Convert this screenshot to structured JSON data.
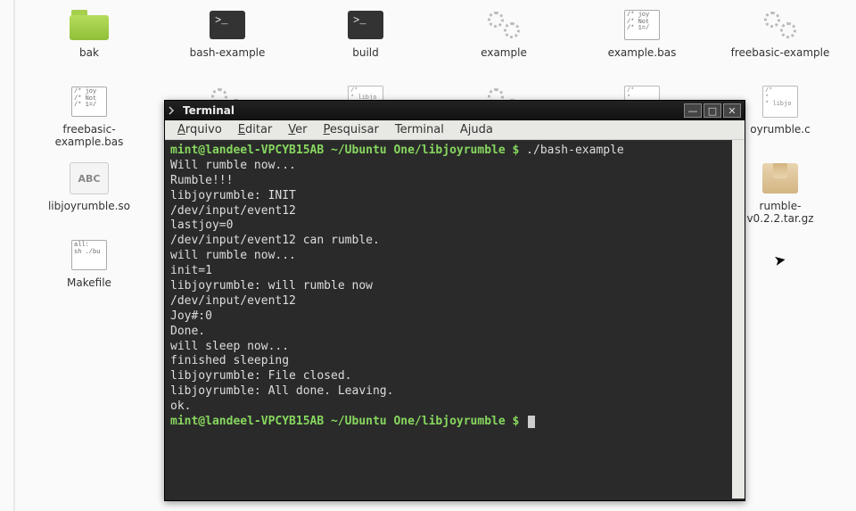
{
  "desktop_icons": [
    {
      "label": "bak",
      "kind": "folder"
    },
    {
      "label": "bash-example",
      "kind": "exe"
    },
    {
      "label": "build",
      "kind": "exe"
    },
    {
      "label": "example",
      "kind": "gear"
    },
    {
      "label": "example.bas",
      "kind": "script",
      "preview": "/* joy\n/* Not\n/* 1=/"
    },
    {
      "label": "freebasic-example",
      "kind": "gear"
    },
    {
      "label": "freebasic-example.bas",
      "kind": "script",
      "preview": "/* joy\n/* Not\n/* 1=/"
    },
    {
      "label": "",
      "kind": "gear"
    },
    {
      "label": "",
      "kind": "text",
      "preview": "/*\n* libjo"
    },
    {
      "label": "",
      "kind": "gear"
    },
    {
      "label": "",
      "kind": "text",
      "preview": "/*\n*\n*"
    },
    {
      "label": "oyrumble.c",
      "kind": "text",
      "preview": "/*\n*\n* libjo"
    },
    {
      "label": "libjoyrumble.so",
      "kind": "so"
    },
    {
      "label": "",
      "kind": "none"
    },
    {
      "label": "",
      "kind": "none"
    },
    {
      "label": "",
      "kind": "none"
    },
    {
      "label": "",
      "kind": "none"
    },
    {
      "label": "rumble-v0.2.2.tar.gz",
      "kind": "archive"
    },
    {
      "label": "Makefile",
      "kind": "script",
      "preview": "all:\nsh ./bu"
    }
  ],
  "terminal": {
    "title": "Terminal",
    "menu": {
      "arquivo": "Arquivo",
      "editar": "Editar",
      "ver": "Ver",
      "pesquisar": "Pesquisar",
      "terminal": "Terminal",
      "ajuda": "Ajuda"
    },
    "prompt_user": "mint@landeel-VPCYB15AB",
    "prompt_path": "~/Ubuntu One/libjoyrumble",
    "prompt_sym": "$",
    "command": "./bash-example",
    "output": [
      "Will rumble now...",
      "Rumble!!!",
      "libjoyrumble: INIT",
      "/dev/input/event12",
      "lastjoy=0",
      "/dev/input/event12 can rumble.",
      "will rumble now...",
      "init=1",
      "libjoyrumble: will rumble now",
      "/dev/input/event12",
      "Joy#:0",
      "Done.",
      "will sleep now...",
      "finished sleeping",
      "libjoyrumble: File closed.",
      "libjoyrumble: All done. Leaving.",
      "ok."
    ],
    "window_buttons": {
      "min": "—",
      "max": "□",
      "close": "✕"
    }
  }
}
